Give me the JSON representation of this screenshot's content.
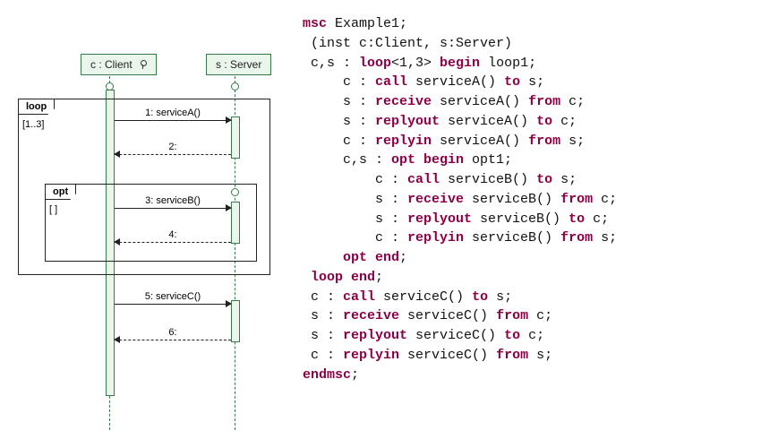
{
  "diagram": {
    "lifeline_client": "c : Client",
    "lifeline_server": "s : Server",
    "frag_loop_label": "loop",
    "frag_loop_guard": "[1..3]",
    "frag_opt_label": "opt",
    "frag_opt_guard": "[ ]",
    "msg1": "1: serviceA()",
    "msg2": "2:",
    "msg3": "3: serviceB()",
    "msg4": "4:",
    "msg5": "5: serviceC()",
    "msg6": "6:"
  },
  "code": {
    "l1a": "msc",
    "l1b": " Example1;",
    "l2": " (inst c:Client, s:Server)",
    "l3a": " c,s : ",
    "l3b": "loop",
    "l3c": "<1,3> ",
    "l3d": "begin",
    "l3e": " loop1;",
    "l4a": "     c : ",
    "l4b": "call",
    "l4c": " serviceA() ",
    "l4d": "to",
    "l4e": " s;",
    "l5a": "     s : ",
    "l5b": "receive",
    "l5c": " serviceA() ",
    "l5d": "from",
    "l5e": " c;",
    "l6a": "     s : ",
    "l6b": "replyout",
    "l6c": " serviceA() ",
    "l6d": "to",
    "l6e": " c;",
    "l7a": "     c : ",
    "l7b": "replyin",
    "l7c": " serviceA() ",
    "l7d": "from",
    "l7e": " s;",
    "l8a": "     c,s : ",
    "l8b": "opt begin",
    "l8c": " opt1;",
    "l9a": "         c : ",
    "l9b": "call",
    "l9c": " serviceB() ",
    "l9d": "to",
    "l9e": " s;",
    "l10a": "         s : ",
    "l10b": "receive",
    "l10c": " serviceB() ",
    "l10d": "from",
    "l10e": " c;",
    "l11a": "         s : ",
    "l11b": "replyout",
    "l11c": " serviceB() ",
    "l11d": "to",
    "l11e": " c;",
    "l12a": "         c : ",
    "l12b": "replyin",
    "l12c": " serviceB() ",
    "l12d": "from",
    "l12e": " s;",
    "l13a": "     ",
    "l13b": "opt end",
    "l13c": ";",
    "l14a": " ",
    "l14b": "loop end",
    "l14c": ";",
    "l15a": " c : ",
    "l15b": "call",
    "l15c": " serviceC() ",
    "l15d": "to",
    "l15e": " s;",
    "l16a": " s : ",
    "l16b": "receive",
    "l16c": " serviceC() ",
    "l16d": "from",
    "l16e": " c;",
    "l17a": " s : ",
    "l17b": "replyout",
    "l17c": " serviceC() ",
    "l17d": "to",
    "l17e": " c;",
    "l18a": " c : ",
    "l18b": "replyin",
    "l18c": " serviceC() ",
    "l18d": "from",
    "l18e": " s;",
    "l19": "endmsc",
    "l19b": ";"
  },
  "chart_data": {
    "type": "sequence-diagram",
    "instances": [
      {
        "id": "c",
        "class": "Client"
      },
      {
        "id": "s",
        "class": "Server"
      }
    ],
    "fragments": [
      {
        "kind": "loop",
        "guard": "[1..3]",
        "contains": [
          "m1",
          "m2",
          "m3",
          "m4"
        ],
        "nested": [
          {
            "kind": "opt",
            "guard": "[]",
            "contains": [
              "m3",
              "m4"
            ]
          }
        ]
      }
    ],
    "messages": [
      {
        "id": "m1",
        "n": 1,
        "from": "c",
        "to": "s",
        "label": "serviceA()",
        "kind": "call"
      },
      {
        "id": "m2",
        "n": 2,
        "from": "s",
        "to": "c",
        "label": "",
        "kind": "reply"
      },
      {
        "id": "m3",
        "n": 3,
        "from": "c",
        "to": "s",
        "label": "serviceB()",
        "kind": "call"
      },
      {
        "id": "m4",
        "n": 4,
        "from": "s",
        "to": "c",
        "label": "",
        "kind": "reply"
      },
      {
        "id": "m5",
        "n": 5,
        "from": "c",
        "to": "s",
        "label": "serviceC()",
        "kind": "call"
      },
      {
        "id": "m6",
        "n": 6,
        "from": "s",
        "to": "c",
        "label": "",
        "kind": "reply"
      }
    ]
  }
}
